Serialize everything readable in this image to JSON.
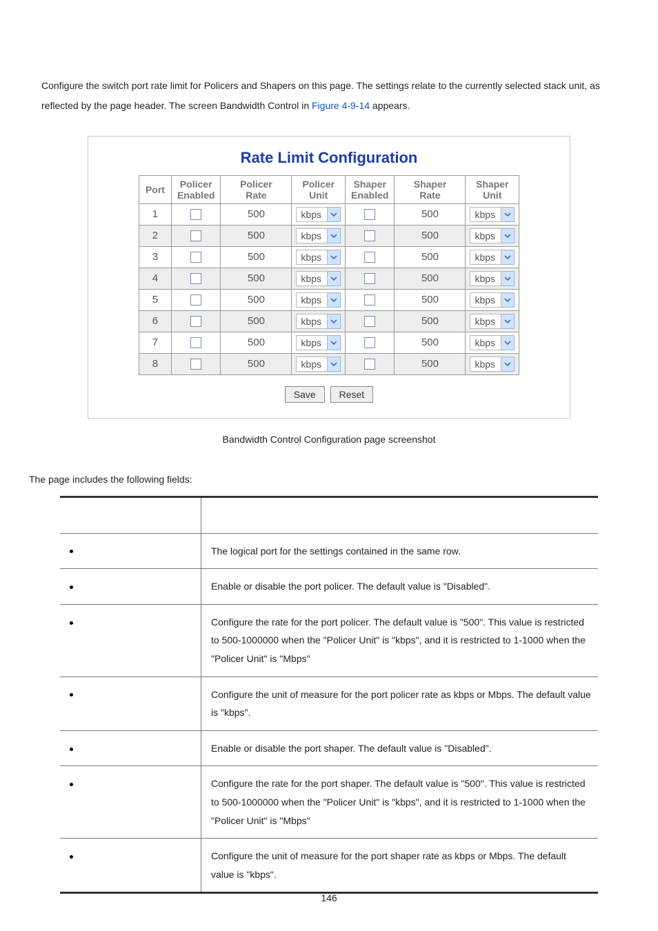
{
  "intro": {
    "t1": "Configure the switch port rate limit for Policers and Shapers on this page. The settings relate to the currently selected stack unit, as reflected by the page header. The screen Bandwidth Control in ",
    "link": "Figure 4-9-14",
    "t2": " appears."
  },
  "title": "Rate Limit Configuration",
  "headers": {
    "port": "Port",
    "policer_enabled": "Policer\nEnabled",
    "policer_rate": "Policer\nRate",
    "policer_unit": "Policer\nUnit",
    "shaper_enabled": "Shaper\nEnabled",
    "shaper_rate": "Shaper\nRate",
    "shaper_unit": "Shaper\nUnit"
  },
  "rows": [
    {
      "port": "1",
      "pe": false,
      "pr": "500",
      "pu": "kbps",
      "se": false,
      "sr": "500",
      "su": "kbps"
    },
    {
      "port": "2",
      "pe": false,
      "pr": "500",
      "pu": "kbps",
      "se": false,
      "sr": "500",
      "su": "kbps"
    },
    {
      "port": "3",
      "pe": false,
      "pr": "500",
      "pu": "kbps",
      "se": false,
      "sr": "500",
      "su": "kbps"
    },
    {
      "port": "4",
      "pe": false,
      "pr": "500",
      "pu": "kbps",
      "se": false,
      "sr": "500",
      "su": "kbps"
    },
    {
      "port": "5",
      "pe": false,
      "pr": "500",
      "pu": "kbps",
      "se": false,
      "sr": "500",
      "su": "kbps"
    },
    {
      "port": "6",
      "pe": false,
      "pr": "500",
      "pu": "kbps",
      "se": false,
      "sr": "500",
      "su": "kbps"
    },
    {
      "port": "7",
      "pe": false,
      "pr": "500",
      "pu": "kbps",
      "se": false,
      "sr": "500",
      "su": "kbps"
    },
    {
      "port": "8",
      "pe": false,
      "pr": "500",
      "pu": "kbps",
      "se": false,
      "sr": "500",
      "su": "kbps"
    }
  ],
  "buttons": {
    "save": "Save",
    "reset": "Reset"
  },
  "caption": "Bandwidth Control Configuration page screenshot",
  "fields_intro": "The page includes the following fields:",
  "fields": [
    {
      "label": "",
      "desc": "The logical port for the settings contained in the same row."
    },
    {
      "label": "",
      "desc": "Enable or disable the port policer. The default value is \"Disabled\"."
    },
    {
      "label": "",
      "desc": "Configure the rate for the port policer. The default value is \"500\". This value is restricted to 500-1000000 when the \"Policer Unit\" is \"kbps\", and it is restricted to 1-1000 when the \"Policer Unit\" is \"Mbps\""
    },
    {
      "label": "",
      "desc": "Configure the unit of measure for the port policer rate as kbps or Mbps. The default value is \"kbps\"."
    },
    {
      "label": "",
      "desc": "Enable or disable the port shaper. The default value is \"Disabled\"."
    },
    {
      "label": "",
      "desc": "Configure the rate for the port shaper. The default value is \"500\". This value is restricted to 500-1000000 when the \"Policer Unit\" is \"kbps\", and it is restricted to 1-1000 when the \"Policer Unit\" is \"Mbps\""
    },
    {
      "label": "",
      "desc": "Configure the unit of measure for the port shaper rate as kbps or Mbps. The default value is \"kbps\"."
    }
  ],
  "page_number": "146"
}
